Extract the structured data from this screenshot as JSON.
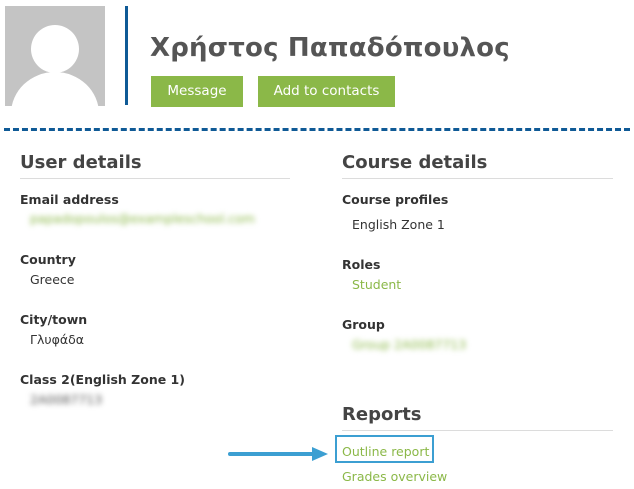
{
  "header": {
    "user_name": "Χρήστος Παπαδόπουλος",
    "message_button": "Message",
    "add_contacts_button": "Add to contacts"
  },
  "user_details": {
    "title": "User details",
    "email_label": "Email address",
    "email_value": "papadopoulos@exampleschool.com",
    "country_label": "Country",
    "country_value": "Greece",
    "city_label": "City/town",
    "city_value": "Γλυφάδα",
    "class_label": "Class 2(English Zone 1)",
    "class_value": "2A0087713"
  },
  "course_details": {
    "title": "Course details",
    "profiles_label": "Course profiles",
    "profiles_value": "English Zone 1",
    "roles_label": "Roles",
    "roles_value": "Student",
    "group_label": "Group",
    "group_value": "Group 2A0087713"
  },
  "reports": {
    "title": "Reports",
    "outline_report": "Outline report",
    "grades_overview": "Grades overview"
  },
  "colors": {
    "accent_green": "#8bb848",
    "divider_blue": "#0f5a96",
    "highlight_blue": "#3c9fd2"
  }
}
